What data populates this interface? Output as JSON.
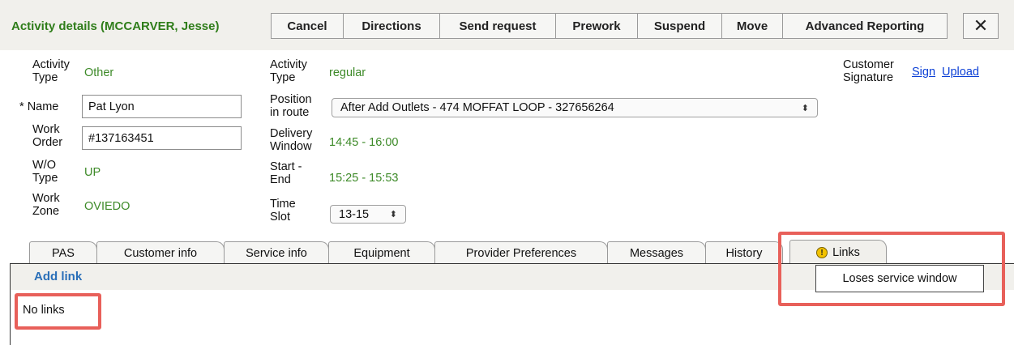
{
  "header": {
    "title": "Activity details (MCCARVER, Jesse)",
    "buttons": {
      "cancel": "Cancel",
      "directions": "Directions",
      "send_request": "Send request",
      "prework": "Prework",
      "suspend": "Suspend",
      "move": "Move",
      "advanced_reporting": "Advanced Reporting",
      "close": "✕"
    }
  },
  "fields": {
    "activity_type_left": {
      "label1": "Activity",
      "label2": "Type",
      "value": "Other"
    },
    "name": {
      "required_mark": "*",
      "label": "Name",
      "value": "Pat Lyon"
    },
    "work_order": {
      "label1": "Work",
      "label2": "Order",
      "value": "#137163451"
    },
    "wo_type": {
      "label1": "W/O",
      "label2": "Type",
      "value": "UP"
    },
    "work_zone": {
      "label1": "Work",
      "label2": "Zone",
      "value": "OVIEDO"
    },
    "activity_type_mid": {
      "label1": "Activity",
      "label2": "Type",
      "value": "regular"
    },
    "position_in_route": {
      "label1": "Position",
      "label2": "in route",
      "value": "After Add Outlets - 474 MOFFAT LOOP - 327656264"
    },
    "delivery_window": {
      "label1": "Delivery",
      "label2": "Window",
      "value": "14:45 - 16:00"
    },
    "start_end": {
      "label1": "Start -",
      "label2": "End",
      "value": "15:25 - 15:53"
    },
    "time_slot": {
      "label1": "Time",
      "label2": "Slot",
      "value": "13-15"
    },
    "customer_signature": {
      "label1": "Customer",
      "label2": "Signature",
      "sign": "Sign",
      "upload": "Upload"
    }
  },
  "tabs": {
    "pas": "PAS",
    "customer_info": "Customer info",
    "service_info": "Service info",
    "equipment": "Equipment",
    "provider_preferences": "Provider Preferences",
    "messages": "Messages",
    "history": "History",
    "links": "Links"
  },
  "links_panel": {
    "add_link": "Add link",
    "empty_text": "No links",
    "tooltip": "Loses service window"
  },
  "colors": {
    "value_green": "#3d8a28",
    "title_green": "#2f7d1a",
    "highlight_red": "#e8605a",
    "warning_yellow": "#f2c200"
  },
  "icons": {
    "close": "close-icon",
    "warning": "warning-icon",
    "select_caret": "updown-caret-icon"
  }
}
